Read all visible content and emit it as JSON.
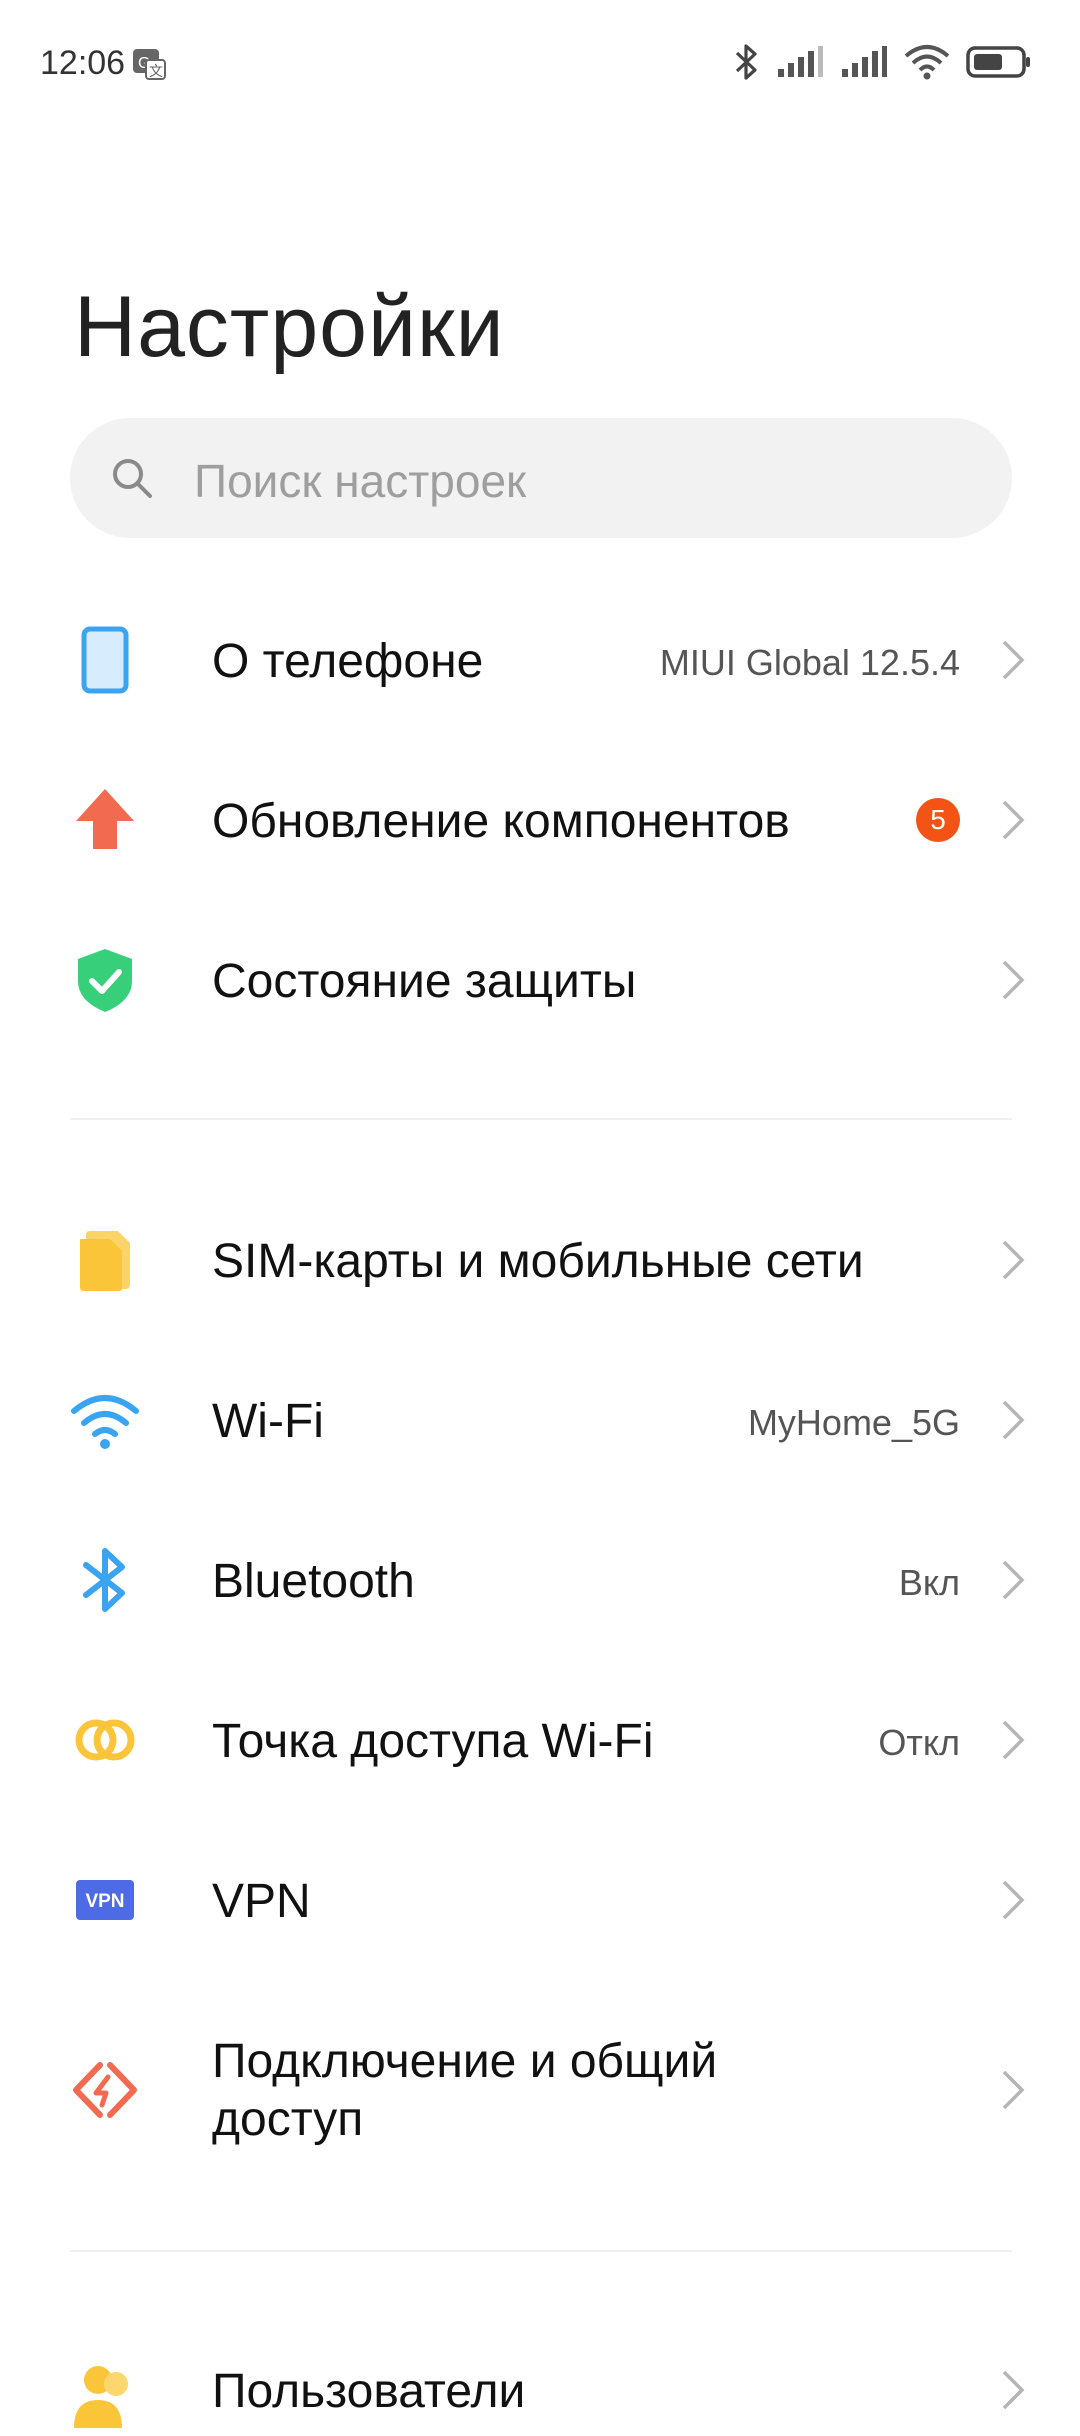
{
  "status_bar": {
    "time": "12:06",
    "icons": [
      "translate-icon",
      "bluetooth-icon",
      "signal-icon",
      "signal-icon",
      "wifi-icon",
      "battery-icon"
    ]
  },
  "header": {
    "title": "Настройки"
  },
  "search": {
    "placeholder": "Поиск настроек"
  },
  "items": [
    {
      "label": "О телефоне",
      "value": "MIUI Global 12.5.4",
      "icon": "phone-icon"
    },
    {
      "label": "Обновление компонентов",
      "badge": "5",
      "icon": "update-arrow-icon"
    },
    {
      "label": "Состояние защиты",
      "icon": "shield-check-icon"
    },
    {
      "label": "SIM-карты и мобильные сети",
      "icon": "sim-card-icon"
    },
    {
      "label": "Wi-Fi",
      "value": "MyHome_5G",
      "icon": "wifi-icon"
    },
    {
      "label": "Bluetooth",
      "value": "Вкл",
      "icon": "bluetooth-icon"
    },
    {
      "label": "Точка доступа Wi-Fi",
      "value": "Откл",
      "icon": "hotspot-icon"
    },
    {
      "label": "VPN",
      "icon": "vpn-icon",
      "icon_text": "VPN"
    },
    {
      "label_line1": "Подключение и общий",
      "label_line2": "доступ",
      "icon": "connection-sharing-icon"
    },
    {
      "label": "Пользователи",
      "icon": "users-icon"
    }
  ],
  "colors": {
    "phone": "#3aa4f0",
    "update": "#f26a50",
    "shield": "#38cf7a",
    "sim": "#fbc53a",
    "wifi": "#3aa4f0",
    "bluetooth": "#3aa4f0",
    "hotspot": "#fbc53a",
    "vpn": "#4e6be6",
    "sharing": "#f26a50",
    "badge": "#f35314"
  }
}
